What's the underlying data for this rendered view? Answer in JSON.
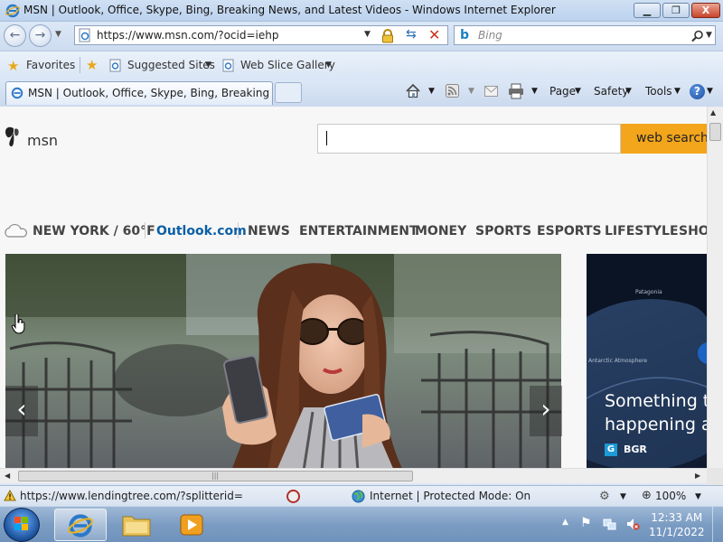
{
  "window": {
    "title": "MSN | Outlook, Office, Skype, Bing, Breaking News, and Latest Videos - Windows Internet Explorer",
    "minimize_glyph": "▁",
    "restore_glyph": "❐",
    "close_glyph": "X"
  },
  "address_bar": {
    "url": "https://www.msn.com/?ocid=iehp",
    "search_placeholder": "Bing"
  },
  "favorites_bar": {
    "favorites_label": "Favorites",
    "suggested_sites_label": "Suggested Sites",
    "web_slice_gallery_label": "Web Slice Gallery"
  },
  "tab": {
    "label": "MSN | Outlook, Office, Skype, Bing, Breaking Ne..."
  },
  "command_bar": {
    "page_label": "Page",
    "safety_label": "Safety",
    "tools_label": "Tools"
  },
  "page": {
    "logo_text": "msn",
    "search_button_label": "web search",
    "weather": "NEW YORK / 60°F",
    "nav": [
      "Outlook.com",
      "NEWS",
      "ENTERTAINMENT",
      "MONEY",
      "SPORTS",
      "ESPORTS",
      "LIFESTYLE",
      "SHO"
    ],
    "side_headline": "Something te happening at",
    "side_source": "BGR",
    "side_photo_caption_1": "Patagonia",
    "side_photo_caption_2": "Antarctic Atmosphere"
  },
  "status_bar": {
    "link_url": "https://www.lendingtree.com/?splitterid=",
    "zone": "Internet | Protected Mode: On",
    "zoom": "100%"
  },
  "taskbar": {
    "time": "12:33 AM",
    "date": "11/1/2022"
  },
  "colors": {
    "search_button": "#f3a51c",
    "outlook_link": "#0a5fa6"
  }
}
